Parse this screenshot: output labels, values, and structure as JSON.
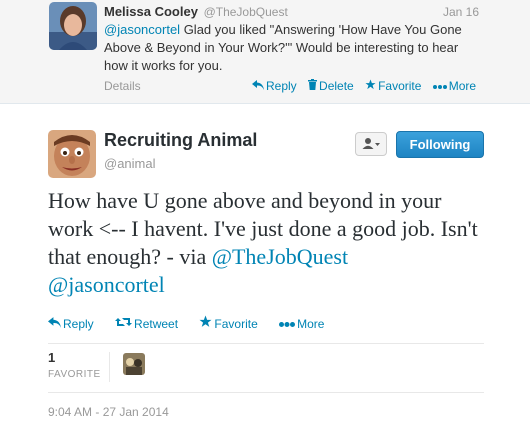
{
  "reply": {
    "name": "Melissa Cooley",
    "handle": "@TheJobQuest",
    "time": "Jan 16",
    "mention": "@jasoncortel",
    "text": " Glad you liked \"Answering 'How Have You Gone Above & Beyond in Your Work?'\" Would be interesting to hear how it works for you.",
    "details": "Details",
    "actions": {
      "reply": "Reply",
      "delete": "Delete",
      "favorite": "Favorite",
      "more": "More"
    }
  },
  "tweet": {
    "name": "Recruiting Animal",
    "handle": "@animal",
    "follow_label": "Following",
    "text_plain": "How have U gone above and beyond in your work <-- I havent. I've just done a good job. Isn't that enough? - via ",
    "mention1": "@TheJobQuest",
    "mention2": "@jasoncortel",
    "actions": {
      "reply": "Reply",
      "retweet": "Retweet",
      "favorite": "Favorite",
      "more": "More"
    },
    "favorite_count": "1",
    "favorite_label": "FAVORITE",
    "timestamp": "9:04 AM - 27 Jan 2014"
  },
  "colors": {
    "link": "#0084b4",
    "follow_button": "#2b90d0",
    "reply_bg": "#f5f5f5"
  },
  "icons": [
    "reply-icon",
    "trash-icon",
    "star-icon",
    "more-dots-icon",
    "retweet-icon",
    "user-dropdown-icon"
  ]
}
